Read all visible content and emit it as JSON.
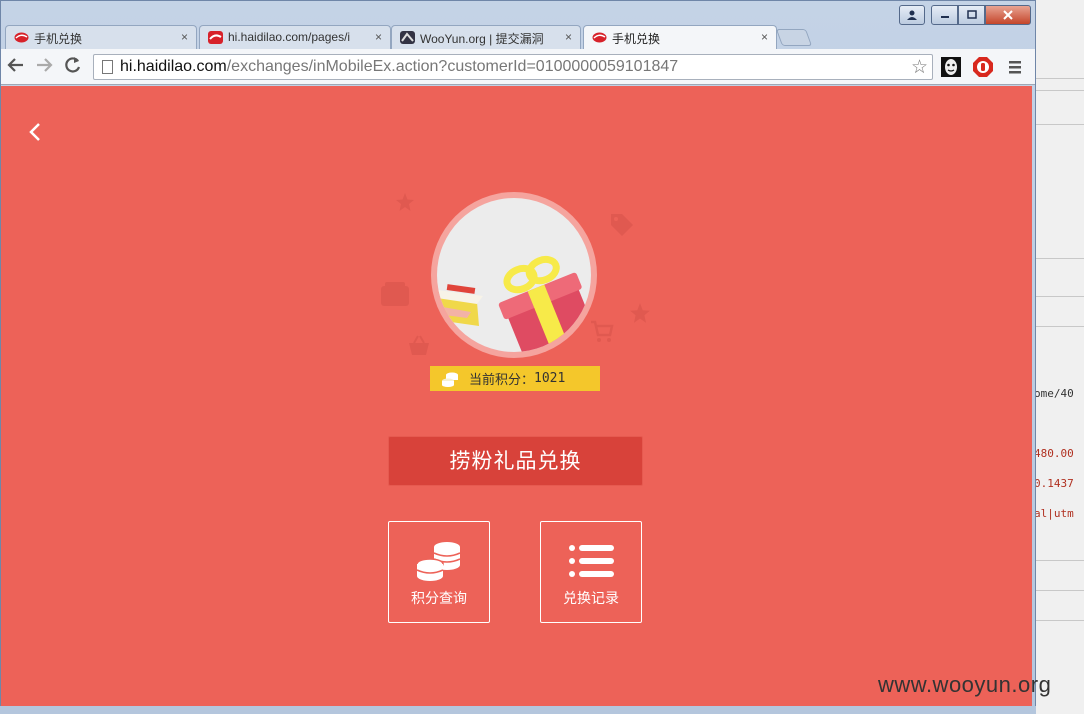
{
  "browser": {
    "tabs": [
      {
        "title": "手机兑换",
        "close": "×"
      },
      {
        "title": "hi.haidilao.com/pages/i",
        "close": "×"
      },
      {
        "title": "WooYun.org | 提交漏洞",
        "close": "×"
      },
      {
        "title": "手机兑换",
        "close": "×"
      }
    ],
    "url_host": "hi.haidilao.com",
    "url_path": "/exchanges/inMobileEx.action?customerId=0100000059101847"
  },
  "page": {
    "points_label": "当前积分：",
    "points_value": "1021",
    "exchange_button": "捞粉礼品兑换",
    "tiles": [
      {
        "label": "积分查询"
      },
      {
        "label": "兑换记录"
      }
    ]
  },
  "background_window": {
    "code_lines": [
      "ome/40",
      "480.00",
      "0.1437",
      "al|utm"
    ]
  },
  "watermark": "www.wooyun.org",
  "colors": {
    "page_bg": "#ed6258",
    "button_bg": "#d8423a",
    "points_bg": "#f4c72b",
    "code_red": "#b03020"
  }
}
